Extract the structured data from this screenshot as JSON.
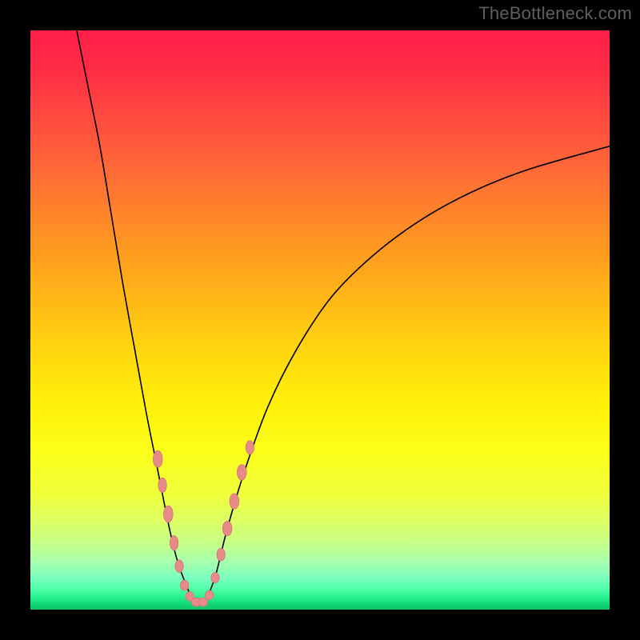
{
  "attribution": "TheBottleneck.com",
  "chart_data": {
    "type": "line",
    "title": "",
    "xlabel": "",
    "ylabel": "",
    "xlim": [
      0,
      100
    ],
    "ylim": [
      0,
      100
    ],
    "grid": false,
    "legend": false,
    "series": [
      {
        "name": "left-curve",
        "x": [
          8,
          10,
          12,
          14,
          16,
          18,
          20,
          22,
          24,
          25.5,
          27,
          27.8
        ],
        "y": [
          100,
          90,
          80,
          68,
          56,
          45,
          34,
          24,
          14,
          8,
          4,
          2
        ]
      },
      {
        "name": "right-curve",
        "x": [
          30.5,
          32,
          34,
          37,
          41,
          46,
          52,
          59,
          67,
          76,
          86,
          100
        ],
        "y": [
          2,
          6,
          14,
          24,
          35,
          45,
          54,
          61,
          67,
          72,
          76,
          80
        ]
      },
      {
        "name": "basin",
        "x": [
          27.8,
          28.5,
          29.2,
          29.9,
          30.5
        ],
        "y": [
          2,
          1.3,
          1.1,
          1.3,
          2
        ]
      }
    ],
    "markers": {
      "name": "data-points-salmon",
      "color": "#e68a8a",
      "points": [
        {
          "x": 22.0,
          "y": 26.0,
          "rx": 4.5,
          "ry": 8
        },
        {
          "x": 22.8,
          "y": 21.5,
          "rx": 4.0,
          "ry": 7
        },
        {
          "x": 23.8,
          "y": 16.5,
          "rx": 4.5,
          "ry": 8
        },
        {
          "x": 24.8,
          "y": 11.5,
          "rx": 4.0,
          "ry": 7
        },
        {
          "x": 25.7,
          "y": 7.5,
          "rx": 4.0,
          "ry": 6
        },
        {
          "x": 26.6,
          "y": 4.2,
          "rx": 4.0,
          "ry": 5
        },
        {
          "x": 27.5,
          "y": 2.3,
          "rx": 4.0,
          "ry": 4.5
        },
        {
          "x": 28.6,
          "y": 1.3,
          "rx": 4.5,
          "ry": 4.2
        },
        {
          "x": 29.8,
          "y": 1.3,
          "rx": 4.5,
          "ry": 4.2
        },
        {
          "x": 30.9,
          "y": 2.5,
          "rx": 4.0,
          "ry": 4.5
        },
        {
          "x": 31.9,
          "y": 5.5,
          "rx": 4.0,
          "ry": 5
        },
        {
          "x": 32.9,
          "y": 9.5,
          "rx": 4.0,
          "ry": 6
        },
        {
          "x": 34.0,
          "y": 14.0,
          "rx": 4.5,
          "ry": 7
        },
        {
          "x": 35.2,
          "y": 18.7,
          "rx": 4.5,
          "ry": 7.5
        },
        {
          "x": 36.5,
          "y": 23.7,
          "rx": 4.5,
          "ry": 7.5
        },
        {
          "x": 37.9,
          "y": 28.0,
          "rx": 4.0,
          "ry": 6.5
        }
      ]
    }
  }
}
